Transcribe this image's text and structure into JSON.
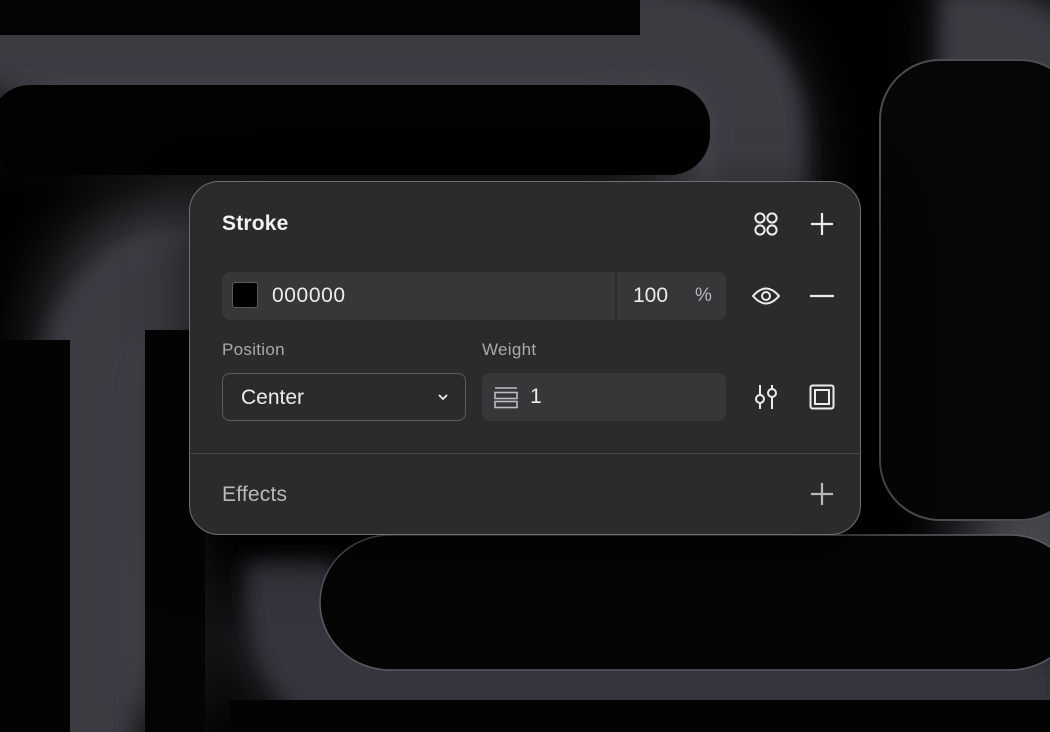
{
  "stroke": {
    "title": "Stroke",
    "color_hex": "000000",
    "opacity": "100",
    "opacity_unit": "%",
    "position_label": "Position",
    "position_value": "Center",
    "weight_label": "Weight",
    "weight_value": "1"
  },
  "effects": {
    "title": "Effects"
  },
  "icons": {
    "styles": "four-dots-icon",
    "add": "plus-icon",
    "visibility": "eye-icon",
    "remove": "minus-icon",
    "dropdown": "chevron-down-icon",
    "weight": "stroke-weight-icon",
    "advanced": "sliders-icon",
    "stroke_sides": "square-frame-icon"
  },
  "colors": {
    "panel_background": "#2b2b2c",
    "field_background": "#37373a",
    "swatch": "#000000",
    "text_primary": "#ececec",
    "text_secondary": "#a9a9ad"
  }
}
